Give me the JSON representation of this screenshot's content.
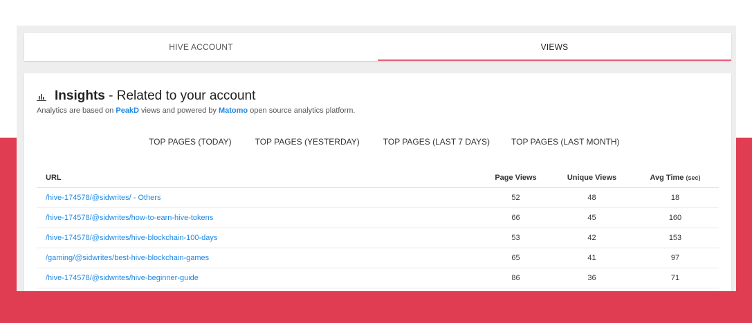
{
  "tabs": [
    {
      "label": "HIVE ACCOUNT",
      "active": false
    },
    {
      "label": "VIEWS",
      "active": true
    }
  ],
  "insights": {
    "icon": "bar-chart-icon",
    "title_bold": "Insights",
    "title_rest": " - Related to your account",
    "subtitle_pre": "Analytics are based on ",
    "subtitle_link1": "PeakD",
    "subtitle_mid": " views and powered by ",
    "subtitle_link2": "Matomo",
    "subtitle_post": " open source analytics platform."
  },
  "subtabs": [
    "TOP PAGES (TODAY)",
    "TOP PAGES (YESTERDAY)",
    "TOP PAGES (LAST 7 DAYS)",
    "TOP PAGES (LAST MONTH)"
  ],
  "table": {
    "headers": {
      "url": "URL",
      "page_views": "Page Views",
      "unique_views": "Unique Views",
      "avg_time": "Avg Time",
      "avg_time_unit": "(sec)"
    },
    "rows": [
      {
        "url": "/hive-174578/@sidwrites/ - Others",
        "page_views": "52",
        "unique_views": "48",
        "avg_time": "18"
      },
      {
        "url": "/hive-174578/@sidwrites/how-to-earn-hive-tokens",
        "page_views": "66",
        "unique_views": "45",
        "avg_time": "160"
      },
      {
        "url": "/hive-174578/@sidwrites/hive-blockchain-100-days",
        "page_views": "53",
        "unique_views": "42",
        "avg_time": "153"
      },
      {
        "url": "/gaming/@sidwrites/best-hive-blockchain-games",
        "page_views": "65",
        "unique_views": "41",
        "avg_time": "97"
      },
      {
        "url": "/hive-174578/@sidwrites/hive-beginner-guide",
        "page_views": "86",
        "unique_views": "36",
        "avg_time": "71"
      }
    ]
  },
  "colors": {
    "accent_red": "#e03c52",
    "tab_indicator": "#e8607a",
    "link_blue": "#1e88e5"
  }
}
